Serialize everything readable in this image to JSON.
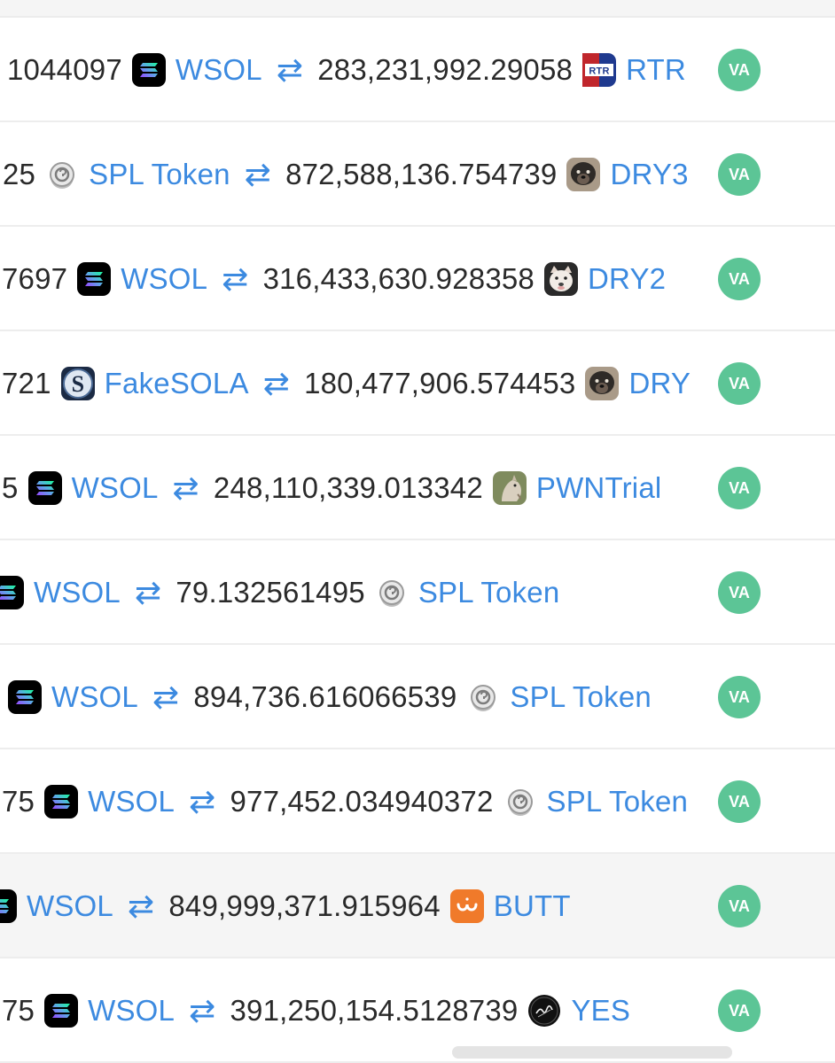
{
  "colors": {
    "link": "#3c8ae0",
    "badge": "#5cc596",
    "amount": "#2a2a2a"
  },
  "rows": [
    {
      "from_amount": "1044097",
      "from_token": "WSOL",
      "from_icon": "solana-icon",
      "to_amount": "283,231,992.29058",
      "to_token": "RTR",
      "to_icon": "rtr-token-icon",
      "badge": "VA"
    },
    {
      "from_amount": "25",
      "from_token": "SPL Token",
      "from_icon": "spl-token-icon",
      "to_amount": "872,588,136.754739",
      "to_token": "DRY3",
      "to_icon": "dog-photo-icon",
      "badge": "VA"
    },
    {
      "from_amount": "7697",
      "from_token": "WSOL",
      "from_icon": "solana-icon",
      "to_amount": "316,433,630.928358",
      "to_token": "DRY2",
      "to_icon": "bulldog-photo-icon",
      "badge": "VA"
    },
    {
      "from_amount": "721",
      "from_token": "FakeSOLA",
      "from_icon": "fake-sola-icon",
      "to_amount": "180,477,906.574453",
      "to_token": "DRY",
      "to_icon": "dog-photo-icon",
      "badge": "VA"
    },
    {
      "from_amount": "5",
      "from_token": "WSOL",
      "from_icon": "solana-icon",
      "to_amount": "248,110,339.013342",
      "to_token": "PWNTrial",
      "to_icon": "horse-photo-icon",
      "badge": "VA"
    },
    {
      "from_amount": "",
      "from_token": "WSOL",
      "from_icon": "solana-icon",
      "to_amount": "79.132561495",
      "to_token": "SPL Token",
      "to_icon": "spl-token-icon",
      "badge": "VA"
    },
    {
      "from_amount": "",
      "from_token": "WSOL",
      "from_icon": "solana-icon",
      "to_amount": "894,736.616066539",
      "to_token": "SPL Token",
      "to_icon": "spl-token-icon",
      "badge": "VA"
    },
    {
      "from_amount": "75",
      "from_token": "WSOL",
      "from_icon": "solana-icon",
      "to_amount": "977,452.034940372",
      "to_token": "SPL Token",
      "to_icon": "spl-token-icon",
      "badge": "VA"
    },
    {
      "from_amount": "",
      "from_token": "WSOL",
      "from_icon": "solana-icon",
      "to_amount": "849,999,371.915964",
      "to_token": "BUTT",
      "to_icon": "butt-token-icon",
      "badge": "VA"
    },
    {
      "from_amount": "75",
      "from_token": "WSOL",
      "from_icon": "solana-icon",
      "to_amount": "391,250,154.5128739",
      "to_token": "YES",
      "to_icon": "yes-token-icon",
      "badge": "VA"
    }
  ],
  "swap_arrow": "⇄"
}
